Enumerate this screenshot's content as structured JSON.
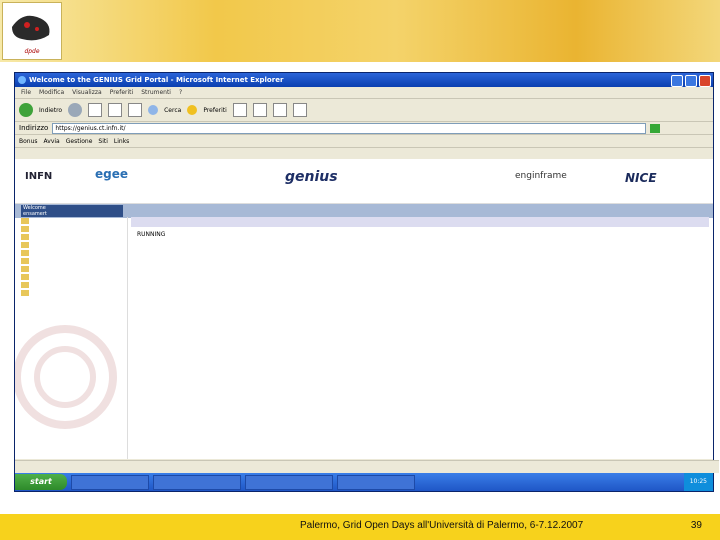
{
  "slide": {
    "footer_text": "Palermo, Grid Open Days all'Università di Palermo, 6-7.12.2007",
    "page_number": "39",
    "logo_text": "dpde"
  },
  "browser": {
    "title": "Welcome to the GENIUS Grid Portal - Microsoft Internet Explorer",
    "menu": [
      "File",
      "Modifica",
      "Visualizza",
      "Preferiti",
      "Strumenti",
      "?"
    ],
    "toolbar": {
      "back": "Indietro",
      "search": "Cerca",
      "favorites": "Preferiti"
    },
    "address_label": "Indirizzo",
    "address_value": "https://genius.ct.infn.it/",
    "links": [
      "Bonus",
      "Avvia",
      "Gestione",
      "Siti",
      "Links"
    ],
    "status_text": "",
    "taskbar": {
      "start": "start",
      "tasks": [
        "",
        "",
        "",
        ""
      ],
      "clock": "10:25"
    }
  },
  "portal": {
    "welcome": "Welcome",
    "welcome_sub": "ensamert",
    "banner_logos": [
      "INFN",
      "egee",
      "genius",
      "enginframe",
      "NICE"
    ],
    "side_items": [
      {
        "label": "",
        "active": false
      },
      {
        "label": "",
        "active": false
      },
      {
        "label": "",
        "active": true
      },
      {
        "label": "",
        "active": false
      },
      {
        "label": "",
        "active": false
      },
      {
        "label": "",
        "active": false
      },
      {
        "label": "",
        "active": false
      },
      {
        "label": "",
        "active": false
      },
      {
        "label": "",
        "active": false
      },
      {
        "label": "",
        "active": false
      }
    ],
    "main_header": "",
    "job_status": "RUNNING"
  }
}
